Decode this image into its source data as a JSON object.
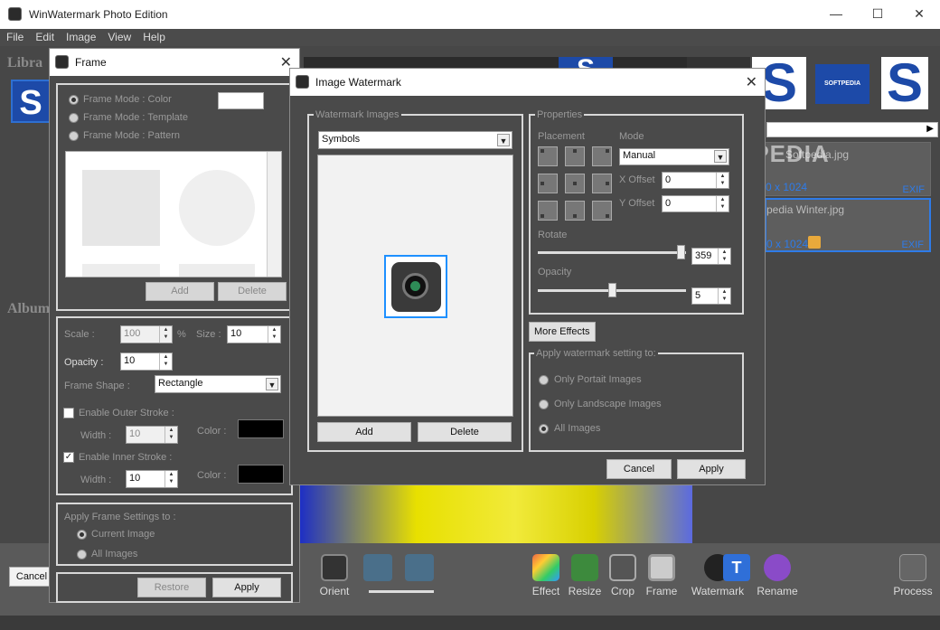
{
  "app": {
    "title": "WinWatermark Photo Edition"
  },
  "menu": [
    "File",
    "Edit",
    "Image",
    "View",
    "Help"
  ],
  "library": {
    "label": "Libra",
    "album_label": "Album"
  },
  "thumbs": [
    {
      "text": "S"
    },
    {
      "text": "S"
    },
    {
      "text": "SOFTPEDIA"
    },
    {
      "text": "S"
    }
  ],
  "files": [
    {
      "name": "Softpedia.jpg",
      "dims": "0 x 1024",
      "exif": "EXIF"
    },
    {
      "name": "pedia Winter.jpg",
      "dims": "0 x 1024",
      "exif": "EXIF"
    }
  ],
  "toolbar": {
    "cancel": "Cancel",
    "orient": "Orient",
    "tools": [
      "Effect",
      "Resize",
      "Crop",
      "Frame",
      "Watermark",
      "Rename"
    ],
    "process": "Process"
  },
  "frame": {
    "title": "Frame",
    "mode_color": "Frame Mode : Color",
    "mode_template": "Frame Mode : Template",
    "mode_pattern": "Frame Mode : Pattern",
    "add": "Add",
    "delete": "Delete",
    "scale_label": "Scale :",
    "scale_value": "100",
    "percent": "%",
    "size_label": "Size :",
    "size_value": "10",
    "opacity_label": "Opacity :",
    "opacity_value": "10",
    "shape_label": "Frame Shape :",
    "shape_value": "Rectangle",
    "outer_label": "Enable Outer Stroke :",
    "outer_width_label": "Width :",
    "outer_width_value": "10",
    "outer_color_label": "Color :",
    "inner_label": "Enable Inner Stroke :",
    "inner_width_label": "Width :",
    "inner_width_value": "10",
    "inner_color_label": "Color :",
    "apply_to_label": "Apply Frame Settings to :",
    "current_image": "Current Image",
    "all_images": "All Images",
    "restore": "Restore",
    "apply": "Apply"
  },
  "watermark": {
    "title": "Image Watermark",
    "images_label": "Watermark Images",
    "category": "Symbols",
    "add": "Add",
    "delete": "Delete",
    "properties_label": "Properties",
    "placement_label": "Placement",
    "mode_label": "Mode",
    "mode_value": "Manual",
    "x_offset_label": "X Offset",
    "x_offset_value": "0",
    "y_offset_label": "Y Offset",
    "y_offset_value": "0",
    "rotate_label": "Rotate",
    "rotate_value": "359",
    "opacity_label": "Opacity",
    "opacity_value": "5",
    "more_effects": "More Effects",
    "apply_setting_label": "Apply watermark setting to:",
    "only_portrait": "Only Portait Images",
    "only_landscape": "Only Landscape Images",
    "all_images": "All Images",
    "cancel": "Cancel",
    "apply": "Apply",
    "rotate_fraction": 0.99,
    "opacity_fraction": 0.5
  },
  "colors": {
    "accent": "#1e90ff",
    "brand": "#1d4aa8",
    "yellow": "#e8e000"
  },
  "softpedia_watermark": "SOFTPEDIA"
}
